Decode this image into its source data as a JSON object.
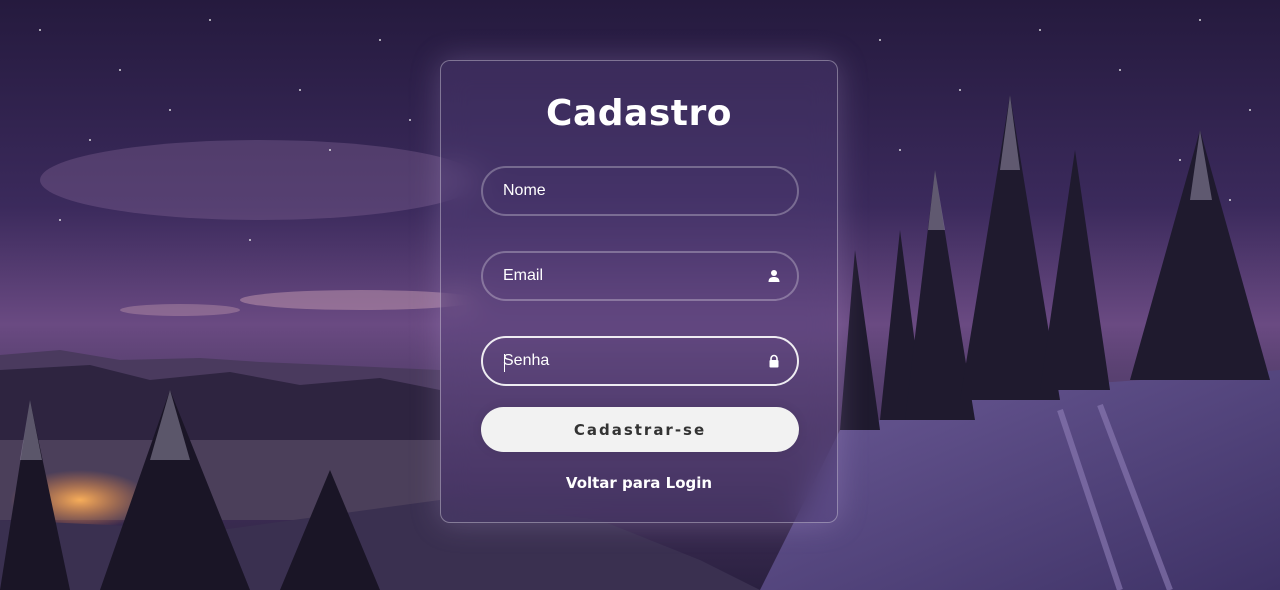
{
  "form": {
    "title": "Cadastro",
    "name_placeholder": "Nome",
    "email_placeholder": "Email",
    "password_placeholder": "Senha",
    "submit_label": "Cadastrar-se",
    "back_link": "Voltar para Login"
  },
  "icons": {
    "email_field_icon": "user-icon",
    "password_field_icon": "lock-icon"
  },
  "colors": {
    "card_border": "#ffffff",
    "button_bg": "#f2f2f2",
    "button_text": "#333333",
    "text": "#ffffff"
  }
}
